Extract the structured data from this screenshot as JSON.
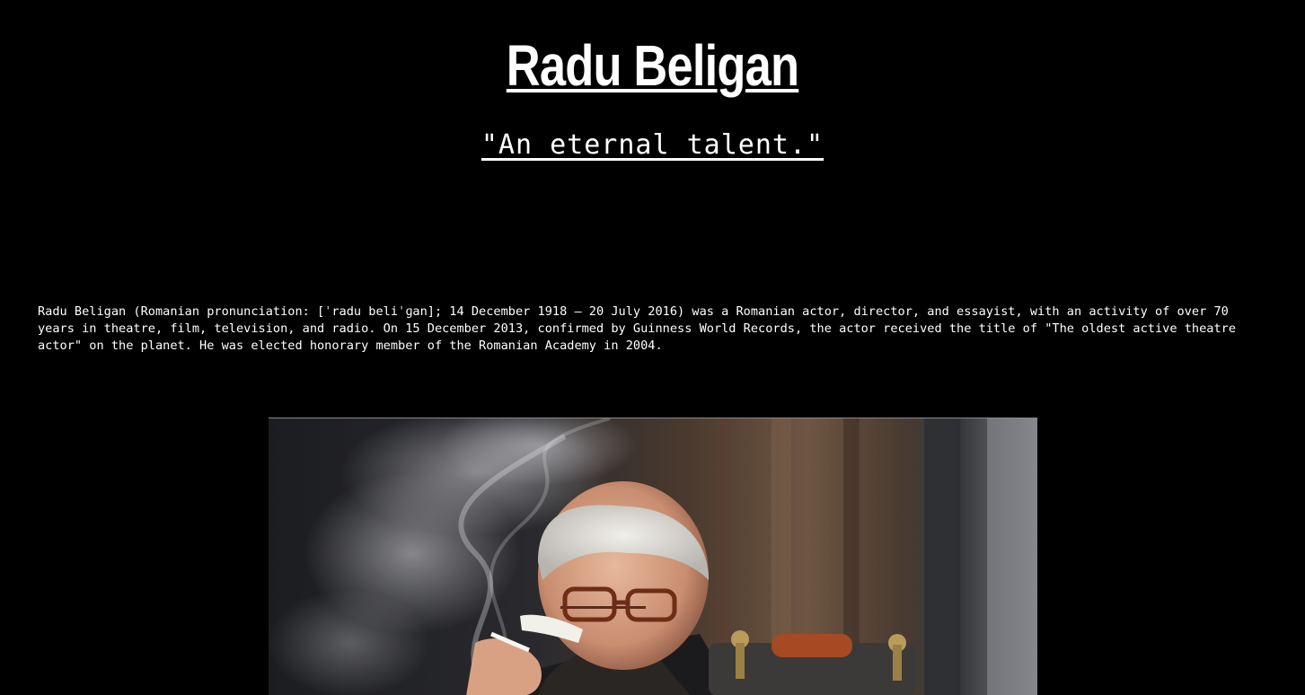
{
  "page": {
    "background": "#000000",
    "text_color": "#ffffff"
  },
  "header": {
    "title": "Radu Beligan",
    "tagline": "\"An eternal talent.\""
  },
  "bio": {
    "text": "Radu Beligan (Romanian pronunciation: [ˈradu beliˈɡan]; 14 December 1918 – 20 July 2016) was a Romanian actor, director, and essayist, with an activity of over 70 years in theatre, film, television, and radio. On 15 December 2013, confirmed by Guinness World Records, the actor received the title of \"The oldest active theatre actor\" on the planet. He was elected honorary member of the Romanian Academy in 2004."
  },
  "image": {
    "subject": "photo-of-radu-beligan-smoking-cigarette"
  }
}
